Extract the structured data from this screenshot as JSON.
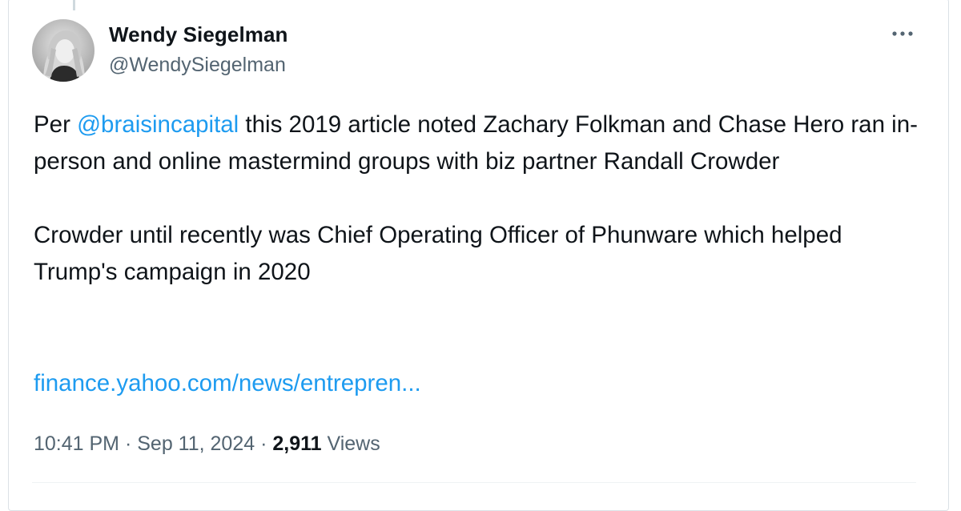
{
  "author": {
    "display_name": "Wendy Siegelman",
    "handle": "@WendySiegelman",
    "avatar_icon": "avatar-photo"
  },
  "menu": {
    "icon": "more-horizontal-icon"
  },
  "tweet": {
    "line1_prefix": "Per ",
    "mention": "@braisincapital",
    "line1_suffix": " this 2019 article noted Zachary Folkman and Chase Hero ran in-person and online mastermind groups with biz partner Randall Crowder",
    "paragraph2": "Crowder until recently was Chief Operating Officer of Phunware which helped Trump's campaign in 2020",
    "link_text": "finance.yahoo.com/news/entrepren..."
  },
  "meta": {
    "time": "10:41 PM",
    "separator": " · ",
    "date": "Sep 11, 2024",
    "views_count": "2,911",
    "views_label": "Views"
  },
  "colors": {
    "link": "#1d9bf0",
    "text": "#0f1419",
    "secondary": "#536471",
    "border": "#dbe1e6"
  }
}
